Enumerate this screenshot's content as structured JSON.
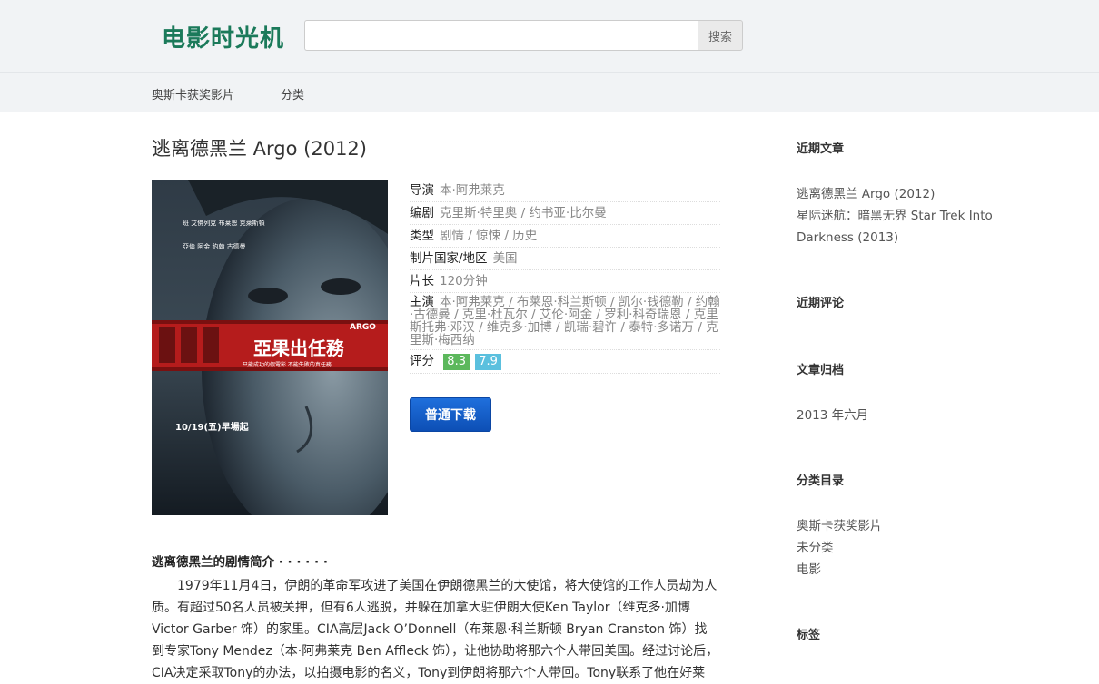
{
  "header": {
    "logo": "电影时光机",
    "search_placeholder": "",
    "search_button": "搜索"
  },
  "nav": {
    "items": [
      {
        "label": "奥斯卡获奖影片"
      },
      {
        "label": "分类"
      }
    ]
  },
  "post": {
    "title": "逃离德黑兰 Argo (2012)",
    "poster": {
      "credits_line1": "班 艾佛列克    布莱恩 克萊斯頓",
      "credits_line2": "亞倫 阿金    約翰 古德曼",
      "brand": "ARGO",
      "cn_title": "亞果出任務",
      "tagline": "只能成功的假電影 不能失敗的真任務",
      "release": "10/19(五)早場起"
    },
    "info": [
      {
        "label": "导演",
        "value": "本·阿弗莱克"
      },
      {
        "label": "编剧",
        "value": "克里斯·特里奥 / 约书亚·比尔曼"
      },
      {
        "label": "类型",
        "value": "剧情 / 惊悚 / 历史"
      },
      {
        "label": "制片国家/地区",
        "value": "美国"
      },
      {
        "label": "片长",
        "value": "120分钟"
      },
      {
        "label": "主演",
        "value": "本·阿弗莱克 / 布莱恩·科兰斯顿 / 凯尔·钱德勒 / 约翰·古德曼 / 克里·杜瓦尔 / 艾伦·阿金 / 罗利·科奇瑞恩 / 克里斯托弗·邓汉 / 维克多·加博 / 凯瑞·碧许 / 泰特·多诺万 / 克里斯·梅西纳"
      }
    ],
    "rating": {
      "label": "评分",
      "score1": "8.3",
      "score2": "7.9"
    },
    "download_button": "普通下载",
    "synopsis": {
      "title": "逃离德黑兰的剧情简介 · · · · · ·",
      "text": "1979年11月4日，伊朗的革命军攻进了美国在伊朗德黑兰的大使馆，将大使馆的工作人员劫为人质。有超过50名人员被关押，但有6人逃脱，并躲在加拿大驻伊朗大使Ken Taylor（维克多·加博 Victor Garber 饰）的家里。CIA高层Jack O’Donnell（布莱恩·科兰斯顿 Bryan Cranston 饰）找到专家Tony Mendez（本·阿弗莱克 Ben Affleck 饰），让他协助将那六个人带回美国。经过讨论后，CIA决定采取Tony的办法，以拍摄电影的名义，Tony到伊朗将那六个人带回。Tony联系了他在好莱"
    }
  },
  "sidebar": {
    "recent_posts": {
      "title": "近期文章",
      "items": [
        "逃离德黑兰 Argo (2012)",
        "星际迷航：暗黑无界 Star Trek Into Darkness (2013)"
      ]
    },
    "recent_comments": {
      "title": "近期评论"
    },
    "archives": {
      "title": "文章归档",
      "items": [
        "2013 年六月"
      ]
    },
    "categories": {
      "title": "分类目录",
      "items": [
        "奥斯卡获奖影片",
        "未分类",
        "电影"
      ]
    },
    "tags": {
      "title": "标签"
    }
  },
  "colors": {
    "logo": "#1b7a5a",
    "score_green": "#5cb85c",
    "score_blue": "#5bc0de",
    "download": "#1565d0"
  }
}
